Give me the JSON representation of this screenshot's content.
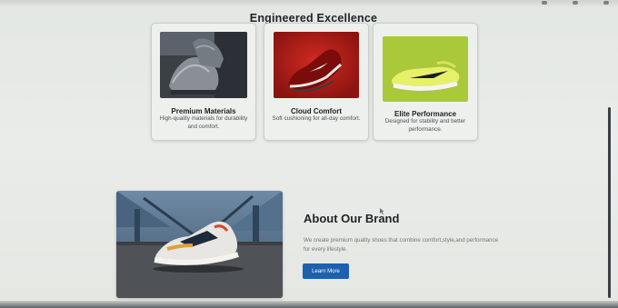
{
  "section": {
    "title": "Engineered Excellence"
  },
  "features": [
    {
      "title": "Premium Materials",
      "description": "High-quality materials for durability and comfort.",
      "image_icon": "grey-knit-sneakers-photo"
    },
    {
      "title": "Cloud Comfort",
      "description": "Soft cushioning for all-day comfort.",
      "image_icon": "red-running-shoe-photo"
    },
    {
      "title": "Elite Performance",
      "description": "Designed for stability and better performance.",
      "image_icon": "lime-training-shoe-photo"
    }
  ],
  "about": {
    "title": "About Our Brand",
    "text": "We create premium quality shoes that combine comfort,style,and performance for every lifestyle.",
    "button_label": "Learn More",
    "image_icon": "sneaker-street-photo"
  },
  "colors": {
    "page_bg": "#e7eae6",
    "button": "#1d5fb0",
    "card_red": "#b8201c",
    "card_lime": "#a9c83a"
  }
}
